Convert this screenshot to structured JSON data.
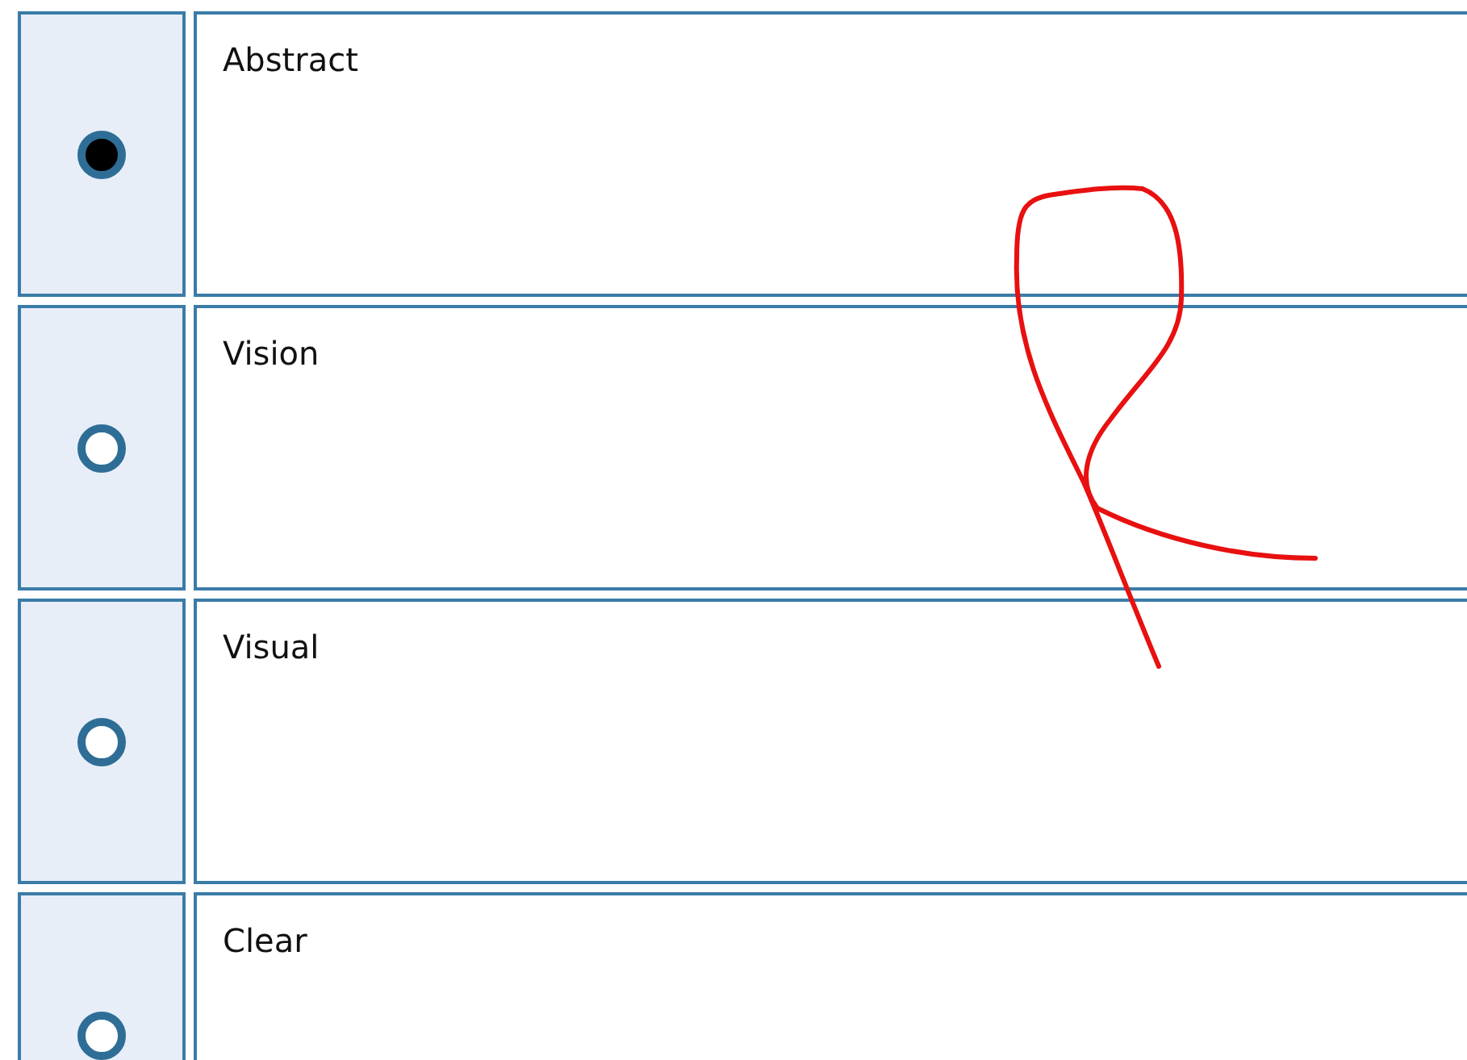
{
  "options": [
    {
      "label": "Abstract",
      "selected": true
    },
    {
      "label": "Vision",
      "selected": false
    },
    {
      "label": "Visual",
      "selected": false
    },
    {
      "label": "Clear",
      "selected": false
    }
  ]
}
